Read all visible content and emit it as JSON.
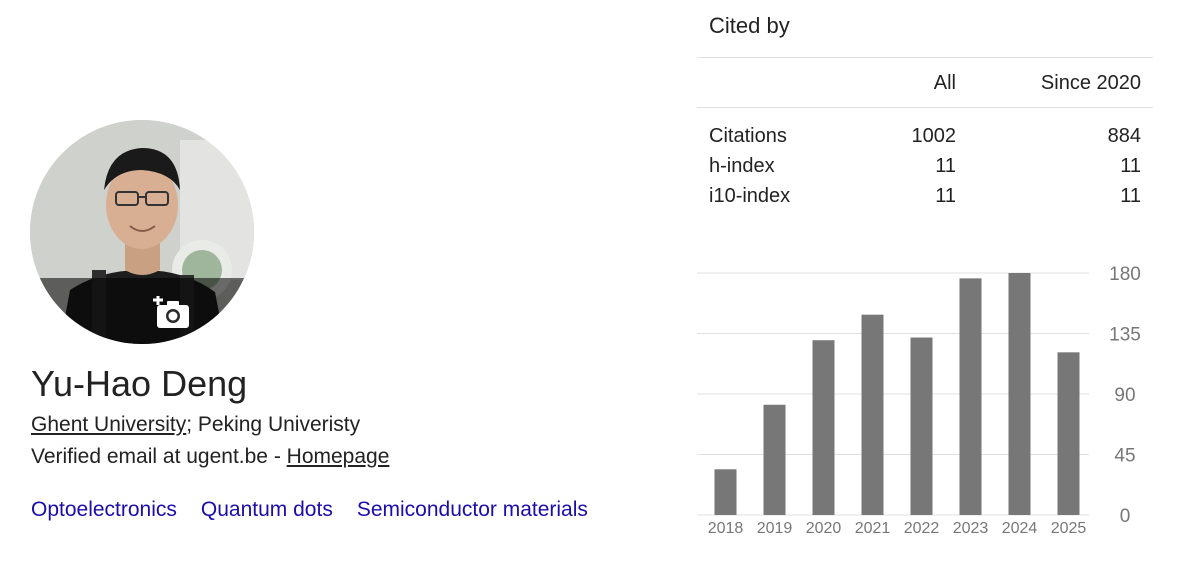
{
  "profile": {
    "name": "Yu-Hao Deng",
    "affiliation_link": "Ghent University",
    "affiliation_rest": "; Peking Univeristy",
    "email_text": "Verified email at ugent.be - ",
    "homepage_label": "Homepage",
    "interests": [
      "Optoelectronics",
      "Quantum dots",
      "Semiconductor materials"
    ],
    "avatar_icon": "add-photo-camera-icon"
  },
  "cited_by": {
    "title": "Cited by",
    "columns": [
      "",
      "All",
      "Since 2020"
    ],
    "rows": [
      {
        "label": "Citations",
        "all": "1002",
        "since": "884"
      },
      {
        "label": "h-index",
        "all": "11",
        "since": "11"
      },
      {
        "label": "i10-index",
        "all": "11",
        "since": "11"
      }
    ]
  },
  "chart_data": {
    "type": "bar",
    "categories": [
      "2018",
      "2019",
      "2020",
      "2021",
      "2022",
      "2023",
      "2024",
      "2025"
    ],
    "values": [
      34,
      82,
      130,
      149,
      132,
      176,
      180,
      121
    ],
    "yticks": [
      "180",
      "135",
      "90",
      "45",
      "0"
    ],
    "ylim": [
      0,
      180
    ],
    "grid": true,
    "bar_color": "#777777",
    "title": "",
    "xlabel": "",
    "ylabel": ""
  },
  "colors": {
    "link": "#1a0dab",
    "text": "#222222",
    "bar": "#777777",
    "grid": "#e0e0e0"
  }
}
